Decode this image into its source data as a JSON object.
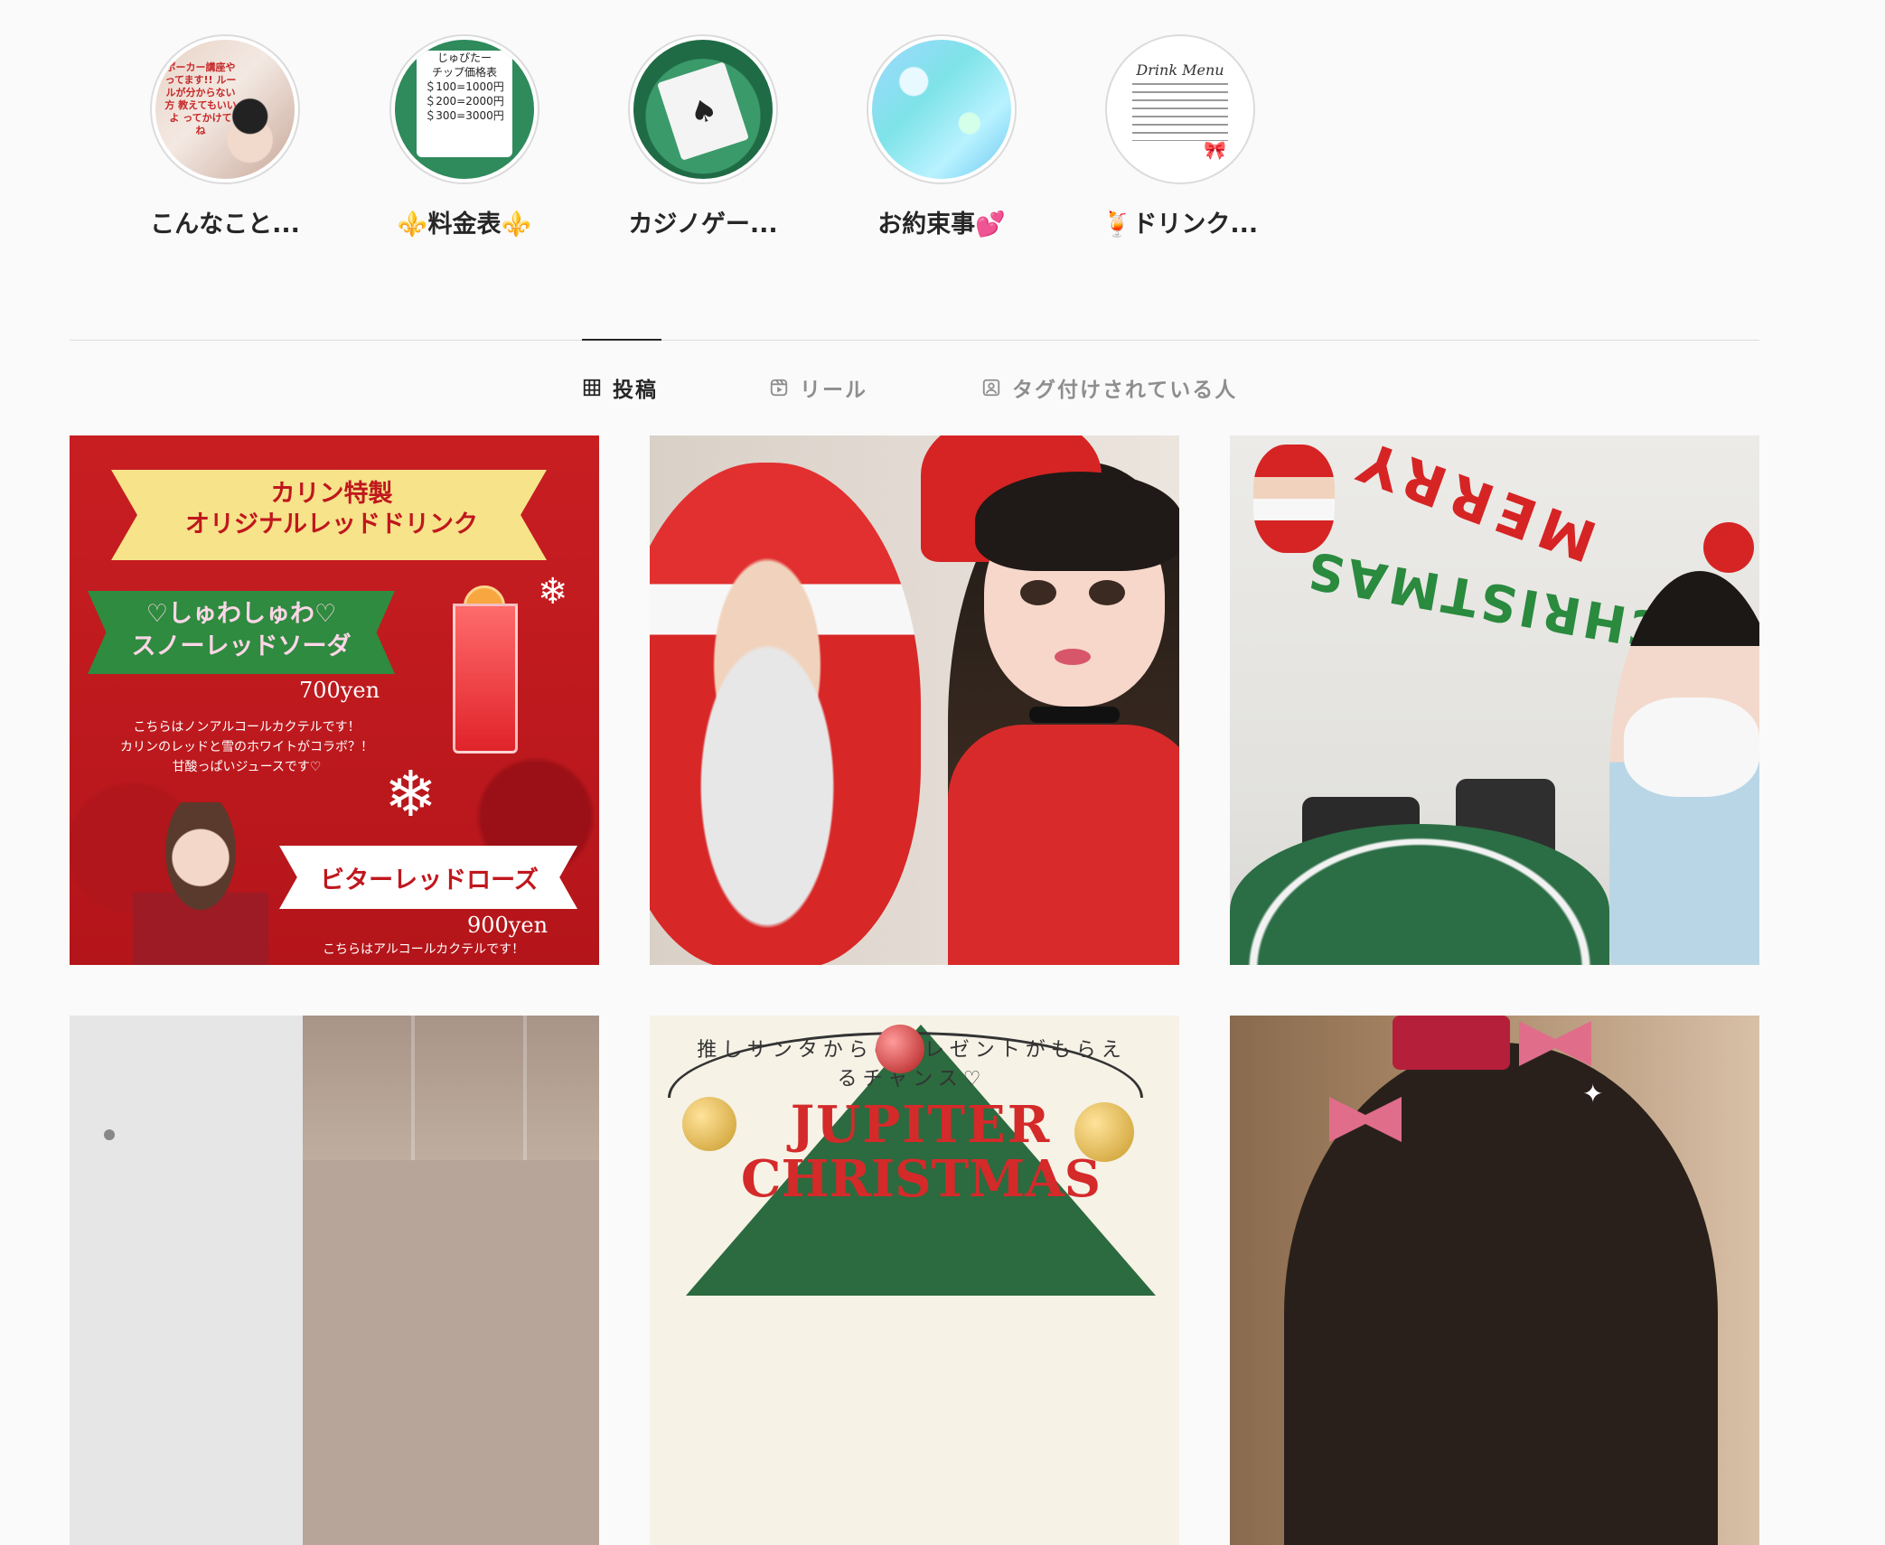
{
  "highlights": [
    {
      "label": "こんなこと...",
      "thumb_text": "ポーカー講座やってます!! ルールが分からない方 教えてもいいよ ってかけてね"
    },
    {
      "label": "⚜️料金表⚜️",
      "thumb_lines": [
        "じゅぴたー",
        "チップ価格表",
        "＄100=1000円",
        "＄200=2000円",
        "＄300=3000円"
      ]
    },
    {
      "label": "カジノゲー..."
    },
    {
      "label": "お約束事💕"
    },
    {
      "label": "🍹ドリンク...",
      "thumb_title": "Drink Menu"
    }
  ],
  "tabs": [
    {
      "label": "投稿",
      "icon": "grid-icon",
      "active": true
    },
    {
      "label": "リール",
      "icon": "reels-icon",
      "active": false
    },
    {
      "label": "タグ付けされている人",
      "icon": "tagged-user-icon",
      "active": false
    }
  ],
  "posts": {
    "p1": {
      "banner": "カリン特製\nオリジナルレッドドリンク",
      "drink1": "♡しゅわしゅわ♡\nスノーレッドソーダ",
      "price1": "700yen",
      "desc1": "こちらはノンアルコールカクテルです！\nカリンのレッドと雪のホワイトがコラボ？！\n甘酸っぱいジュースです♡",
      "drink2": "ビターレッドローズ",
      "price2": "900yen",
      "desc2": "こちらはアルコールカクテルです！"
    },
    "p3": {
      "balloon_word1": "MERRY",
      "balloon_word2": "CHRISTMAS"
    },
    "p5": {
      "arc_text": "推しサンタからのプレゼントがもらえるチャンス♡",
      "title": "JUPITER",
      "title2": "CHRISTMAS"
    }
  },
  "colors": {
    "accent_text": "#262626",
    "muted_text": "#8e8e8e",
    "divider": "#dbdbdb",
    "background": "#fafafa"
  }
}
